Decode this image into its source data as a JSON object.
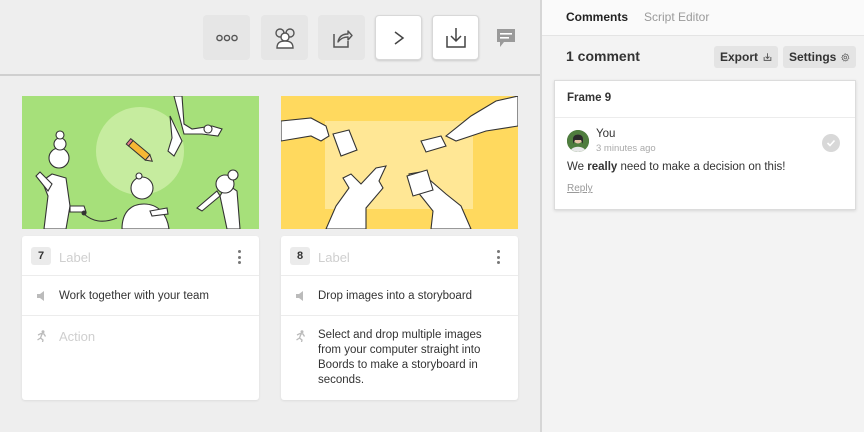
{
  "toolbar": {
    "buttons": [
      {
        "name": "more-options",
        "icon": "ellipsis-icon"
      },
      {
        "name": "team",
        "icon": "team-icon"
      },
      {
        "name": "share",
        "icon": "share-icon"
      },
      {
        "name": "play",
        "icon": "play-icon"
      },
      {
        "name": "download",
        "icon": "download-icon"
      }
    ],
    "comment_toggle_icon": "comment-icon"
  },
  "frames": [
    {
      "number": "7",
      "label_placeholder": "Label",
      "sound_text": "Work together with your team",
      "action_placeholder": "Action",
      "image_color": "#a6e07a"
    },
    {
      "number": "8",
      "label_placeholder": "Label",
      "sound_text": "Drop images into a storyboard",
      "action_text_lines": [
        "Select and drop multiple images",
        "from your computer straight into",
        "Boords to make a storyboard in",
        "seconds."
      ],
      "image_color": "#ffd95e"
    }
  ],
  "panel": {
    "tabs": [
      "Comments",
      "Script Editor"
    ],
    "active_tab": "Comments",
    "comment_count": "1 comment",
    "export_label": "Export",
    "settings_label": "Settings",
    "comment": {
      "frame_title": "Frame 9",
      "author": "You",
      "time": "3 minutes ago",
      "text_before": "We ",
      "text_bold": "really",
      "text_after": " need to make a decision on this!",
      "reply_label": "Reply"
    }
  }
}
